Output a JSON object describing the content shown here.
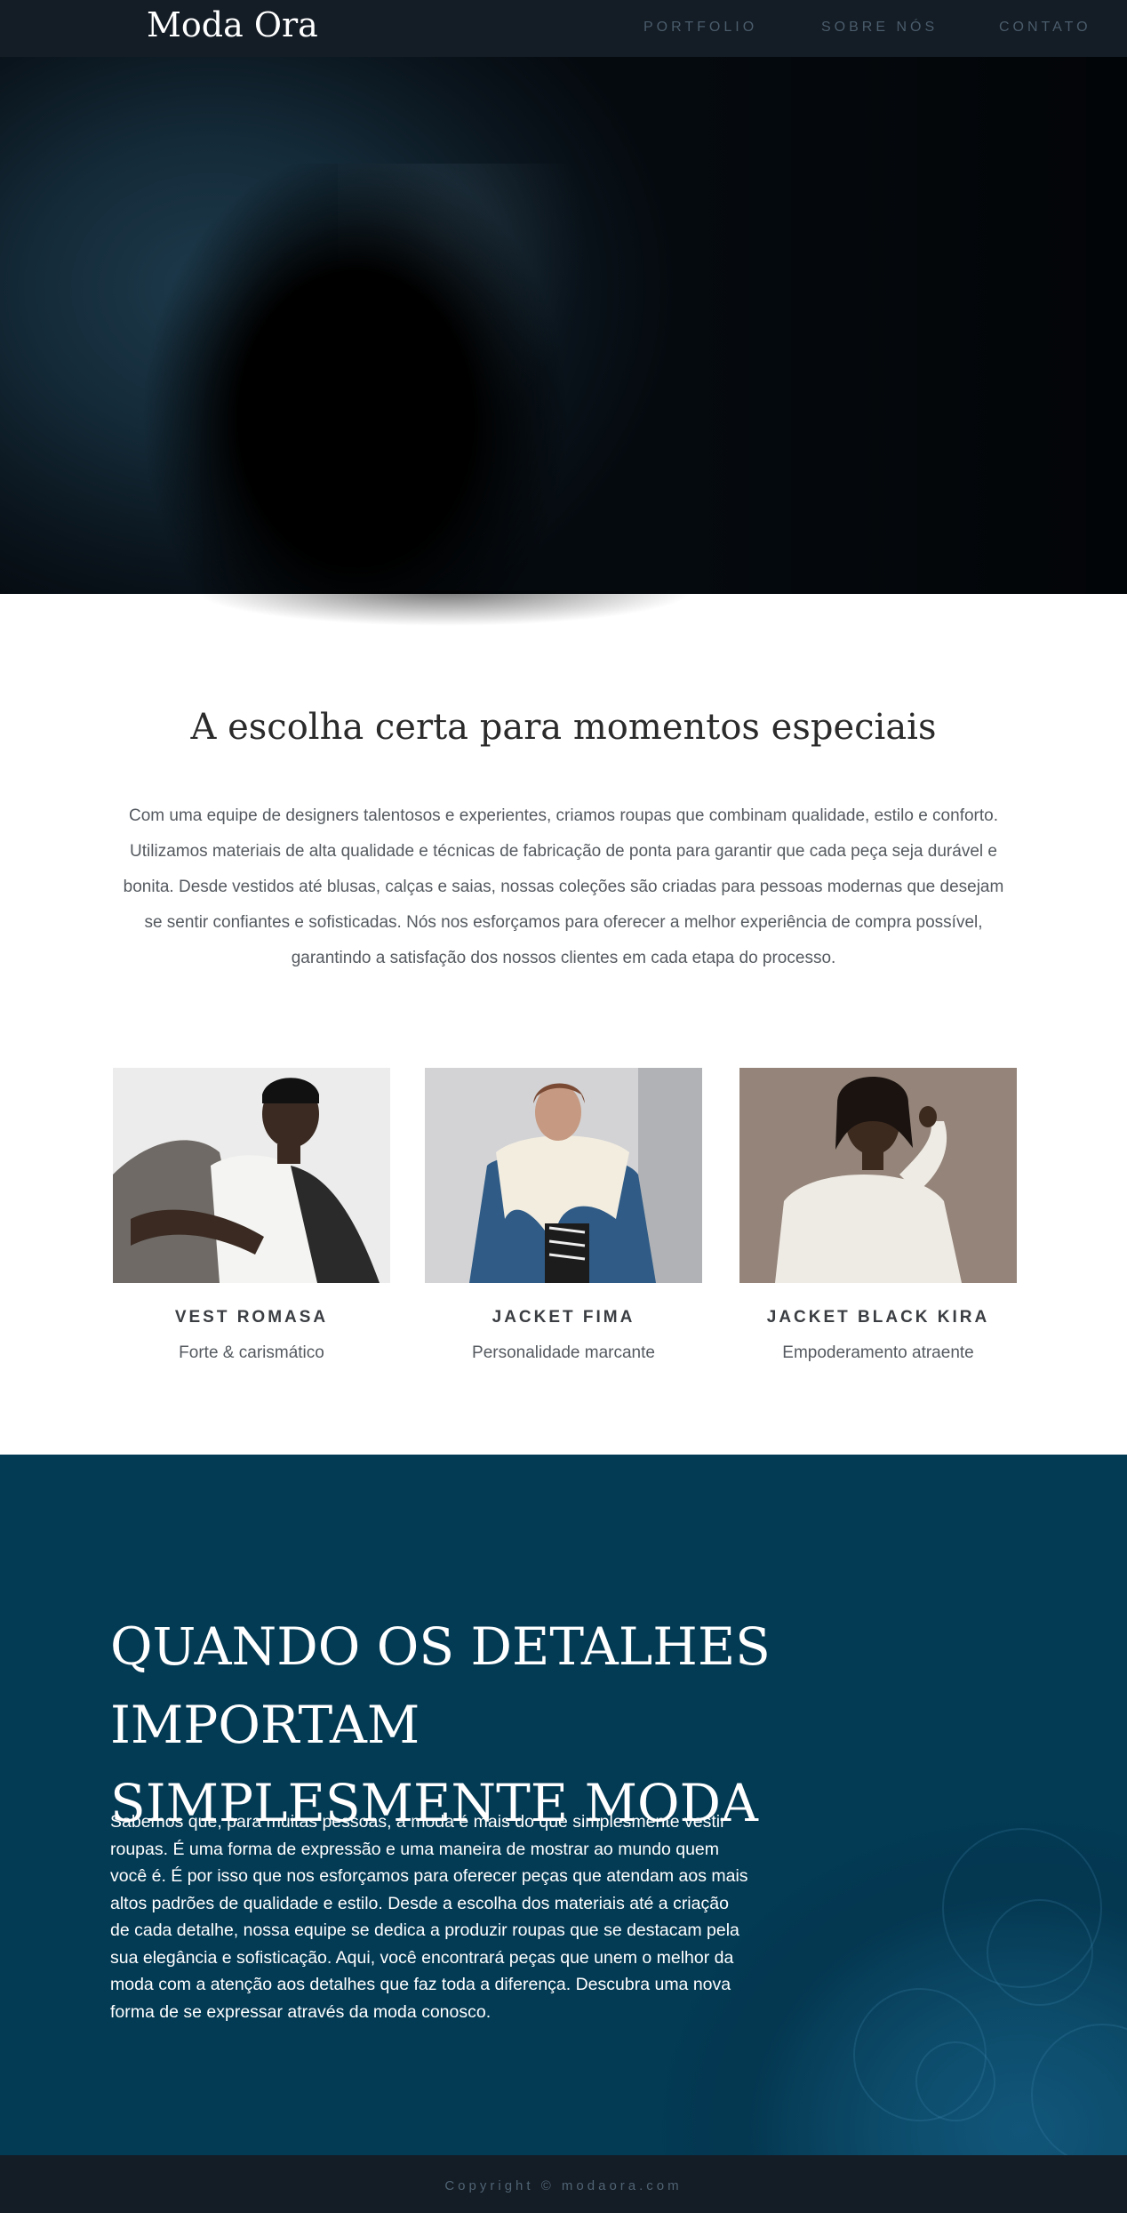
{
  "header": {
    "logo": "Moda Ora",
    "nav": [
      {
        "label": "PORTFOLIO"
      },
      {
        "label": "SOBRE NÓS"
      },
      {
        "label": "CONTATO"
      }
    ]
  },
  "hero": {
    "image": "fashion-model-dark-photo"
  },
  "about": {
    "title": "A escolha certa para momentos especiais",
    "text": "Com uma equipe de designers talentosos e experientes, criamos roupas que combinam qualidade, estilo e conforto. Utilizamos materiais de alta qualidade e técnicas de fabricação de ponta para garantir que cada peça seja durável e bonita. Desde vestidos até blusas, calças e saias, nossas coleções são criadas para pessoas modernas que desejam se sentir confiantes e sofisticadas. Nós nos esforçamos para oferecer a melhor experiência de compra possível, garantindo a satisfação dos nossos clientes em cada etapa do processo."
  },
  "products": [
    {
      "name": "VEST ROMASA",
      "description": "Forte & carismático",
      "image": "man-in-plaid-blazer-photo"
    },
    {
      "name": "JACKET FIMA",
      "description": "Personalidade marcante",
      "image": "woman-in-fur-collar-jacket-photo"
    },
    {
      "name": "JACKET BLACK KIRA",
      "description": "Empoderamento atraente",
      "image": "woman-in-white-blouse-photo"
    }
  ],
  "feature": {
    "title_line1": "QUANDO OS DETALHES IMPORTAM",
    "title_line2": "SIMPLESMENTE MODA",
    "text": "Sabemos que, para muitas pessoas, a moda é mais do que simplesmente vestir roupas. É uma forma de expressão e uma maneira de mostrar ao mundo quem você é. É por isso que nos esforçamos para oferecer peças que atendam aos mais altos padrões de qualidade e estilo. Desde a escolha dos materiais até a criação de cada detalhe, nossa equipe se dedica a produzir roupas que se destacam pela sua elegância e sofisticação. Aqui, você encontrará peças que unem o melhor da moda com a atenção aos detalhes que faz toda a diferença. Descubra uma nova forma de se expressar através da moda conosco."
  },
  "footer": {
    "copyright": "Copyright © modaora.com"
  },
  "colors": {
    "header_bg": "#141c25",
    "feature_bg": "#043750",
    "text_dark": "#2b2b2b",
    "text_body": "#555a60"
  }
}
